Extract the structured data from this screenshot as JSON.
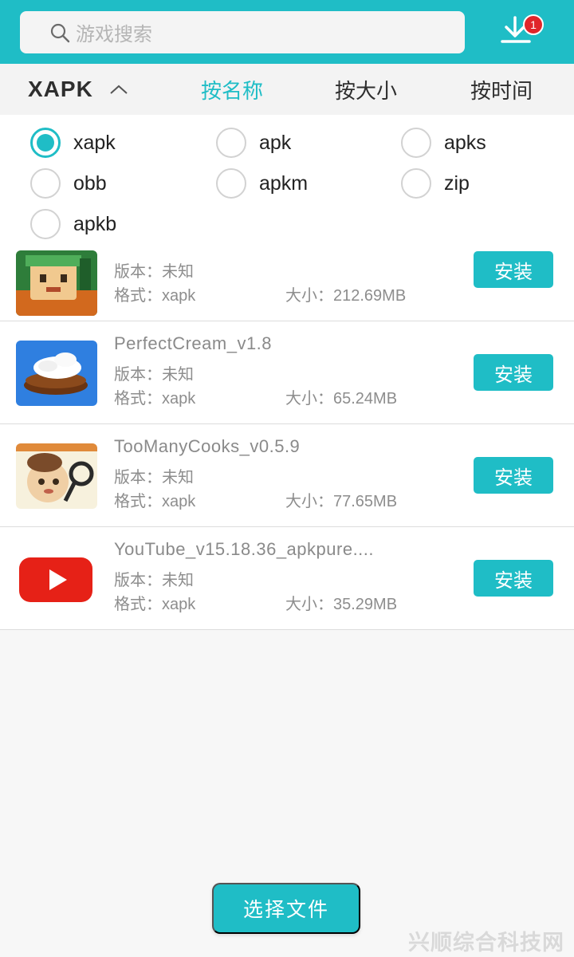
{
  "header": {
    "search_placeholder": "游戏搜索",
    "search_icon": "search-icon",
    "download_icon": "download-icon",
    "download_badge": "1"
  },
  "sort_bar": {
    "type_label": "XAPK",
    "by_name": "按名称",
    "by_size": "按大小",
    "by_time": "按时间",
    "active": "by_name"
  },
  "filters": {
    "options": [
      {
        "label": "xapk",
        "checked": true
      },
      {
        "label": "apk",
        "checked": false
      },
      {
        "label": "apks",
        "checked": false
      },
      {
        "label": "obb",
        "checked": false
      },
      {
        "label": "apkm",
        "checked": false
      },
      {
        "label": "zip",
        "checked": false
      },
      {
        "label": "apkb",
        "checked": false
      }
    ]
  },
  "files": [
    {
      "name": "",
      "version": "版本：未知",
      "format": "格式：xapk",
      "size": "大小：212.69MB",
      "install": "安装",
      "icon": "game-character-icon"
    },
    {
      "name": "PerfectCream_v1.8",
      "version": "版本：未知",
      "format": "格式：xapk",
      "size": "大小：65.24MB",
      "install": "安装",
      "icon": "cream-eclair-icon"
    },
    {
      "name": "TooManyCooks_v0.5.9",
      "version": "版本：未知",
      "format": "格式：xapk",
      "size": "大小：77.65MB",
      "install": "安装",
      "icon": "cook-character-icon"
    },
    {
      "name": "YouTube_v15.18.36_apkpure....",
      "version": "版本：未知",
      "format": "格式：xapk",
      "size": "大小：35.29MB",
      "install": "安装",
      "icon": "youtube-icon"
    }
  ],
  "footer": {
    "choose_file": "选择文件",
    "watermark": "兴顺综合科技网"
  },
  "colors": {
    "accent": "#1fbdc6",
    "badge": "#e0252a"
  }
}
